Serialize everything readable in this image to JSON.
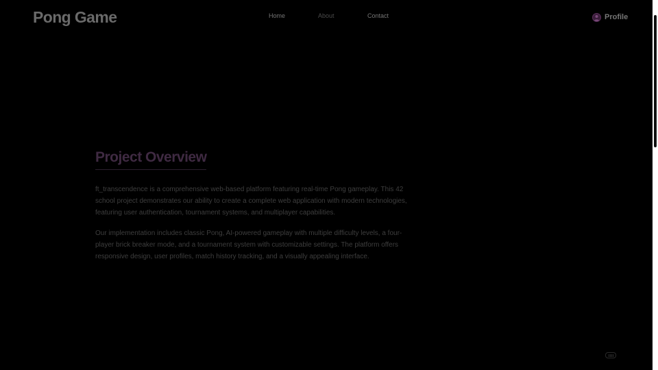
{
  "header": {
    "logo": "Pong Game",
    "nav": [
      {
        "label": "Home",
        "active": false
      },
      {
        "label": "About",
        "active": true
      },
      {
        "label": "Contact",
        "active": false
      }
    ],
    "profile": {
      "label": "Profile",
      "icon": "user-icon"
    }
  },
  "overview": {
    "title": "Project Overview",
    "paragraphs": [
      "ft_transcendence is a comprehensive web-based platform featuring real-time Pong gameplay. This 42 school project demonstrates our ability to create a complete web application with modern technologies, featuring user authentication, tournament systems, and multiplayer capabilities.",
      "Our implementation includes classic Pong, AI-powered gameplay with multiple difficulty levels, a four-player brick breaker mode, and a tournament system with customizable settings. The platform offers responsive design, user profiles, match history tracking, and a visually appealing interface."
    ]
  },
  "colors": {
    "background": "#000000",
    "accent": "#5a2e5a"
  },
  "widget": {
    "icon": "keyboard-icon"
  }
}
